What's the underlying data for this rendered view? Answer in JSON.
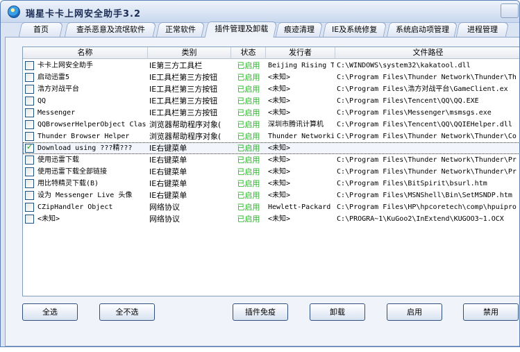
{
  "window": {
    "title": "瑞星卡卡上网安全助手3.2"
  },
  "tabs": [
    {
      "label": "首页"
    },
    {
      "label": "查杀恶意及流氓软件"
    },
    {
      "label": "正常软件"
    },
    {
      "label": "插件管理及卸载",
      "active": true
    },
    {
      "label": "痕迹清理"
    },
    {
      "label": "IE及系统修复"
    },
    {
      "label": "系统启动项管理"
    },
    {
      "label": "进程管理"
    }
  ],
  "table": {
    "columns": [
      "名称",
      "类别",
      "状态",
      "发行者",
      "文件路径"
    ],
    "rows": [
      {
        "checked": false,
        "name": "卡卡上网安全助手",
        "category": "IE第三方工具栏",
        "status": "已启用",
        "publisher": "Beijing Rising T",
        "path": "C:\\WINDOWS\\system32\\kakatool.dll"
      },
      {
        "checked": false,
        "name": "启动迅雷5",
        "category": "IE工具栏第三方按钮",
        "status": "已启用",
        "publisher": "<未知>",
        "path": "C:\\Program Files\\Thunder Network\\Thunder\\Th"
      },
      {
        "checked": false,
        "name": "浩方对战平台",
        "category": "IE工具栏第三方按钮",
        "status": "已启用",
        "publisher": "<未知>",
        "path": "C:\\Program Files\\浩方对战平台\\GameClient.ex"
      },
      {
        "checked": false,
        "name": "QQ",
        "category": "IE工具栏第三方按钮",
        "status": "已启用",
        "publisher": "<未知>",
        "path": "C:\\Program Files\\Tencent\\QQ\\QQ.EXE"
      },
      {
        "checked": false,
        "name": "Messenger",
        "category": "IE工具栏第三方按钮",
        "status": "已启用",
        "publisher": "<未知>",
        "path": "C:\\Program Files\\Messenger\\msmsgs.exe"
      },
      {
        "checked": false,
        "name": "QQBrowserHelperObject Clas",
        "category": "浏览器帮助程序对象(",
        "status": "已启用",
        "publisher": "深圳市腾讯计算机",
        "path": "C:\\Program Files\\Tencent\\QQ\\QQIEHelper.dll"
      },
      {
        "checked": false,
        "name": "Thunder Browser Helper",
        "category": "浏览器帮助程序对象(",
        "status": "已启用",
        "publisher": "Thunder Networki",
        "path": "C:\\Program Files\\Thunder Network\\Thunder\\Co"
      },
      {
        "checked": true,
        "selected": true,
        "name": "Download using ???精???",
        "category": "IE右键菜单",
        "status": "已启用",
        "publisher": "<未知>",
        "path": ""
      },
      {
        "checked": false,
        "name": "使用迅雷下载",
        "category": "IE右键菜单",
        "status": "已启用",
        "publisher": "<未知>",
        "path": "C:\\Program Files\\Thunder Network\\Thunder\\Pr"
      },
      {
        "checked": false,
        "name": "使用迅雷下载全部链接",
        "category": "IE右键菜单",
        "status": "已启用",
        "publisher": "<未知>",
        "path": "C:\\Program Files\\Thunder Network\\Thunder\\Pr"
      },
      {
        "checked": false,
        "name": "用比特精灵下载(B)",
        "category": "IE右键菜单",
        "status": "已启用",
        "publisher": "<未知>",
        "path": "C:\\Program Files\\BitSpirit\\bsurl.htm"
      },
      {
        "checked": false,
        "name": "设为 Messenger Live 头像",
        "category": "IE右键菜单",
        "status": "已启用",
        "publisher": "<未知>",
        "path": "C:\\Program Files\\MSNShell\\Bin\\SetMSNDP.htm"
      },
      {
        "checked": false,
        "name": "CZipHandler Object",
        "category": "网络协议",
        "status": "已启用",
        "publisher": "Hewlett-Packard",
        "path": "C:\\Program Files\\HP\\hpcoretech\\comp\\hpuipro"
      },
      {
        "checked": false,
        "name": "<未知>",
        "category": "网络协议",
        "status": "已启用",
        "publisher": "<未知>",
        "path": "C:\\PROGRA~1\\KuGoo2\\InExtend\\KUGOO3~1.OCX"
      }
    ]
  },
  "buttons": {
    "select_all": "全选",
    "select_none": "全不选",
    "plugin_immune": "插件免疫",
    "uninstall": "卸载",
    "enable": "启用",
    "disable": "禁用"
  },
  "colors": {
    "status_enabled": "#23b323",
    "accent": "#5a7fb8"
  }
}
